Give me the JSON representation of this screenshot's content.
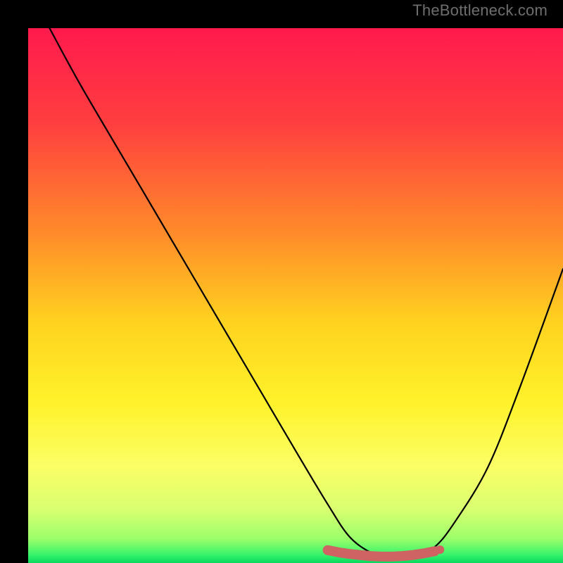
{
  "watermark": "TheBottleneck.com",
  "chart_data": {
    "type": "line",
    "title": "",
    "xlabel": "",
    "ylabel": "",
    "xlim": [
      0,
      100
    ],
    "ylim": [
      0,
      100
    ],
    "grid": false,
    "legend": null,
    "description": "Bottleneck-style curve over a vertical rainbow gradient (red top → green bottom). Curve plunges from top-left, bottoms out around x≈68, then rises to the right. The flat valley is traced with salmon-colored markers.",
    "series": [
      {
        "name": "curve",
        "x": [
          4,
          10,
          20,
          30,
          40,
          50,
          56,
          60,
          64,
          68,
          72,
          76,
          80,
          86,
          92,
          100
        ],
        "y": [
          100,
          89,
          72,
          55,
          38,
          21,
          11,
          5,
          2,
          1,
          1.5,
          3,
          8,
          18,
          33,
          55
        ]
      }
    ],
    "markers": {
      "name": "valley",
      "x": [
        56,
        58,
        60,
        62,
        64,
        66,
        68,
        70,
        72,
        74,
        76
      ],
      "y": [
        2.4,
        2.0,
        1.7,
        1.5,
        1.3,
        1.2,
        1.2,
        1.3,
        1.5,
        1.8,
        2.2
      ],
      "endpoint": {
        "x": 77,
        "y": 2.5
      }
    },
    "gradient_stops": [
      {
        "offset": 0.0,
        "color": "#ff1a4d"
      },
      {
        "offset": 0.18,
        "color": "#ff3f3f"
      },
      {
        "offset": 0.38,
        "color": "#ff8a2a"
      },
      {
        "offset": 0.55,
        "color": "#ffd21f"
      },
      {
        "offset": 0.7,
        "color": "#fff22a"
      },
      {
        "offset": 0.82,
        "color": "#fbff66"
      },
      {
        "offset": 0.9,
        "color": "#d9ff70"
      },
      {
        "offset": 0.955,
        "color": "#9bff6a"
      },
      {
        "offset": 0.985,
        "color": "#36f36b"
      },
      {
        "offset": 1.0,
        "color": "#08d85e"
      }
    ],
    "marker_color": "#cf6262",
    "curve_color": "#000000"
  }
}
